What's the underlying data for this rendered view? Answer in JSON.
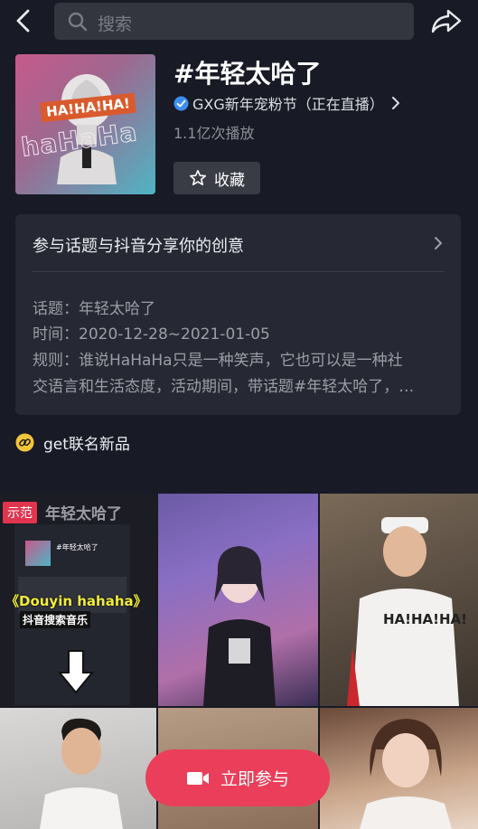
{
  "search": {
    "placeholder": "搜索"
  },
  "header": {
    "title": "#年轻太哈了",
    "live_text": "GXG新年宠粉节（正在直播）",
    "plays": "1.1亿次播放",
    "favorite_label": "收藏",
    "cover_text_1": "HA!HA!HA!",
    "cover_text_2": "haHaHa"
  },
  "info": {
    "heading": "参与话题与抖音分享你的创意",
    "lines": [
      "话题：年轻太哈了",
      "时间：2020-12-28~2021-01-05",
      "规则：谁说HaHaHa只是一种笑声，它也可以是一种社",
      "交语言和生活态度，活动期间，带话题#年轻太哈了，…"
    ]
  },
  "link": {
    "label": "get联名新品"
  },
  "grid": {
    "demo_badge": "示范",
    "demo_title": "年轻太哈了",
    "demo_overlay_1": "《Douyin hahaha》",
    "demo_overlay_2": "抖音搜索音乐",
    "shirt_text": "HA!HA!HA!"
  },
  "cta": {
    "join_label": "立即参与"
  },
  "colors": {
    "accent": "#ea3e5a",
    "background": "#181a25",
    "card": "#262833",
    "verify": "#3c8ef5",
    "link_icon": "#f3c53b"
  }
}
